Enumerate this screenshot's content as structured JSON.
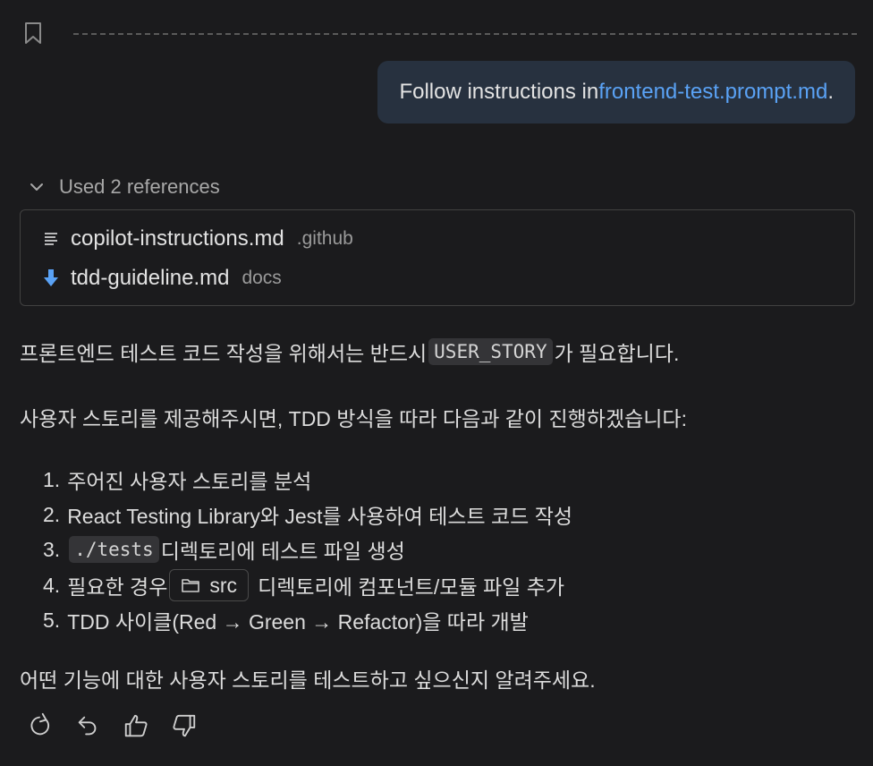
{
  "user_message": {
    "prefix": "Follow instructions in ",
    "link": "frontend-test.prompt.md",
    "suffix": "."
  },
  "references": {
    "header": "Used 2 references",
    "items": [
      {
        "name": "copilot-instructions.md",
        "dir": ".github",
        "icon": "list-lines-icon"
      },
      {
        "name": "tdd-guideline.md",
        "dir": "docs",
        "icon": "download-arrow-icon"
      }
    ]
  },
  "response": {
    "p1_before": "프론트엔드 테스트 코드 작성을 위해서는 반드시 ",
    "p1_code": "USER_STORY",
    "p1_after": "가 필요합니다.",
    "p2": "사용자 스토리를 제공해주시면, TDD 방식을 따라 다음과 같이 진행하겠습니다:",
    "steps": {
      "s1": {
        "num": "1.",
        "text": "주어진 사용자 스토리를 분석"
      },
      "s2": {
        "num": "2.",
        "text": "React Testing Library와 Jest를 사용하여 테스트 코드 작성"
      },
      "s3": {
        "num": "3.",
        "code": "./tests",
        "text": " 디렉토리에 테스트 파일 생성"
      },
      "s4": {
        "num": "4.",
        "before": "필요한 경우",
        "chip": "src",
        "after": "디렉토리에 컴포넌트/모듈 파일 추가"
      },
      "s5": {
        "num": "5.",
        "text": "TDD 사이클(Red → Green → Refactor)을 따라 개발"
      }
    },
    "closing": "어떤 기능에 대한 사용자 스토리를 테스트하고 싶으신지 알려주세요."
  },
  "actions": [
    "retry-icon",
    "undo-icon",
    "thumbs-up-icon",
    "thumbs-down-icon"
  ],
  "colors": {
    "background": "#1b1b1d",
    "bubble": "#27313f",
    "link": "#5aa2f5",
    "download_icon": "#5aa2f5"
  }
}
